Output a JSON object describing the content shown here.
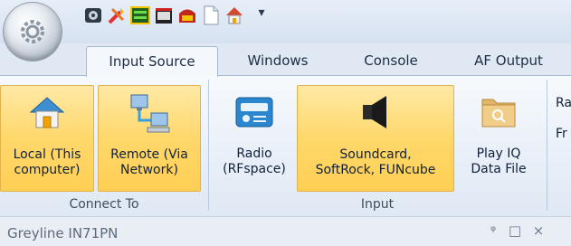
{
  "quick_access": {
    "icons": [
      "settings-icon",
      "tools-icon",
      "spectrum-icon",
      "calendar-icon",
      "record-icon",
      "document-icon",
      "home-icon",
      "customize-dropdown-icon"
    ],
    "dropdown_glyph": "▾"
  },
  "tabs": [
    {
      "label": "Input Source",
      "active": true
    },
    {
      "label": "Windows",
      "active": false
    },
    {
      "label": "Console",
      "active": false
    },
    {
      "label": "AF Output",
      "active": false
    }
  ],
  "groups": {
    "connect_to": {
      "label": "Connect To",
      "buttons": [
        {
          "label": "Local (This\ncomputer)",
          "icon": "home-icon",
          "selected": true
        },
        {
          "label": "Remote (Via\nNetwork)",
          "icon": "network-icon",
          "selected": true
        }
      ]
    },
    "input": {
      "label": "Input",
      "buttons": [
        {
          "label": "Radio\n(RFspace)",
          "icon": "radio-icon",
          "selected": false
        },
        {
          "label": "Soundcard,\nSoftRock, FUNcube",
          "icon": "speaker-icon",
          "selected": true
        },
        {
          "label": "Play IQ\nData File",
          "icon": "folder-icon",
          "selected": false
        }
      ]
    },
    "cut_off": [
      "Ra",
      "Fr"
    ]
  },
  "panel": {
    "title": "Greyline IN71PN",
    "controls": [
      "pin",
      "maximize",
      "close"
    ],
    "pin_glyph": "ᵠ",
    "maximize_glyph": "□",
    "close_glyph": "×"
  },
  "colors": {
    "selected_fill": "#ffd86b",
    "selected_border": "#e2b24b",
    "ribbon_bg": "#e8eff8",
    "tab_text": "#1e2d44"
  }
}
